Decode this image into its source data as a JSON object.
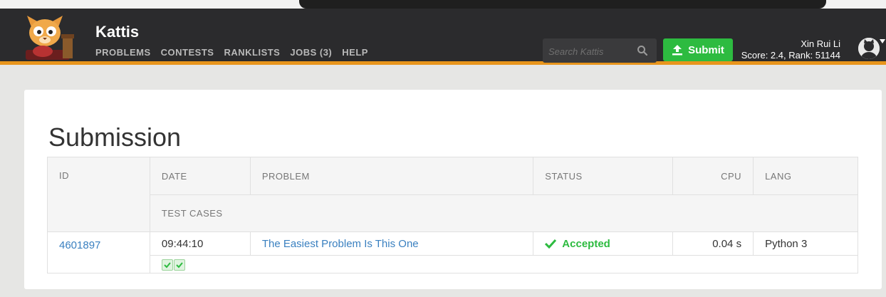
{
  "header": {
    "brand": "Kattis",
    "nav": [
      "PROBLEMS",
      "CONTESTS",
      "RANKLISTS",
      "JOBS (3)",
      "HELP"
    ],
    "search_placeholder": "Search Kattis",
    "submit_label": "Submit",
    "user_name": "Xin Rui Li",
    "user_stats": "Score: 2.4, Rank: 51144"
  },
  "page": {
    "title": "Submission"
  },
  "table": {
    "headers": {
      "id": "ID",
      "date": "DATE",
      "problem": "PROBLEM",
      "status": "STATUS",
      "cpu": "CPU",
      "lang": "LANG",
      "test_cases": "TEST CASES"
    },
    "row": {
      "id": "4601897",
      "date": "09:44:10",
      "problem": "The Easiest Problem Is This One",
      "status": "Accepted",
      "cpu": "0.04 s",
      "lang": "Python 3",
      "test_cases_passed": 2
    }
  },
  "colors": {
    "accent": "#e8951c",
    "success": "#2dbb40",
    "link": "#3a80c0",
    "navbar": "#2b2b2d"
  }
}
